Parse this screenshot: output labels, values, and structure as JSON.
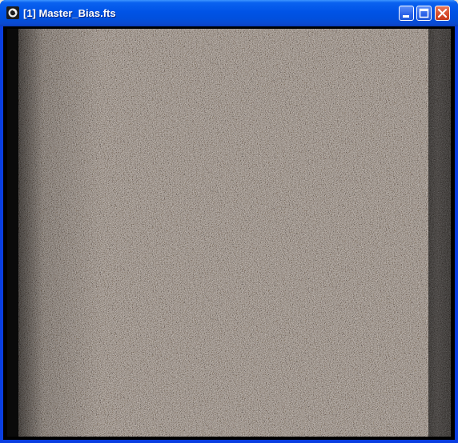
{
  "window": {
    "title": "[1] Master_Bias.fts",
    "icon": "telescope-app-icon",
    "controls": {
      "minimize": "minimize-icon",
      "maximize": "maximize-icon",
      "close": "close-icon"
    }
  },
  "image": {
    "content": "bias-frame-noise",
    "colors": {
      "noise_dark": "#2e2a27",
      "noise_mid": "#8a8480",
      "noise_light": "#e6e1dc",
      "overscan_left": "#0a0a0a",
      "overscan_right": "#342f2d"
    }
  },
  "theme": {
    "titlebar": "#0053e6",
    "frame": "#0a3ee0"
  }
}
